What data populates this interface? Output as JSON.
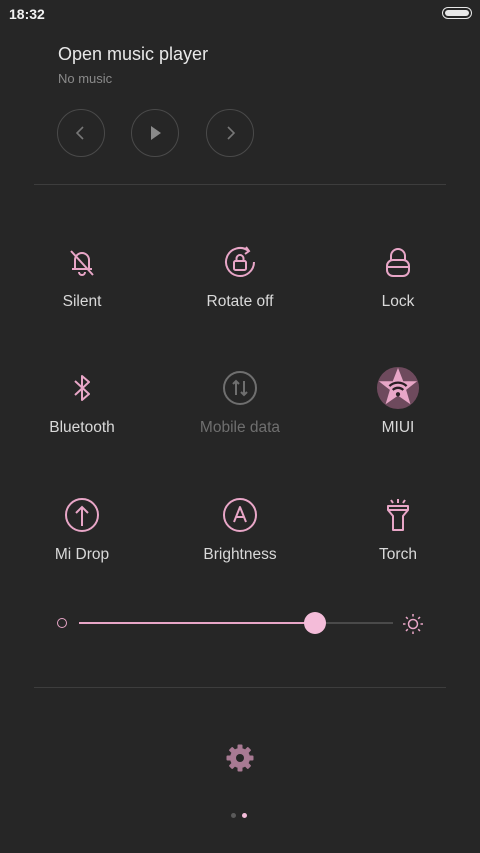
{
  "status_bar": {
    "time": "18:32"
  },
  "music": {
    "title": "Open music player",
    "subtitle": "No music",
    "controls": [
      "previous",
      "play",
      "next"
    ]
  },
  "tiles": [
    {
      "label": "Silent",
      "icon": "bell-off-icon",
      "enabled": true
    },
    {
      "label": "Rotate off",
      "icon": "rotate-lock-icon",
      "enabled": true
    },
    {
      "label": "Lock",
      "icon": "lock-icon",
      "enabled": true
    },
    {
      "label": "Bluetooth",
      "icon": "bluetooth-icon",
      "enabled": true
    },
    {
      "label": "Mobile data",
      "icon": "mobile-data-icon",
      "enabled": false
    },
    {
      "label": "MIUI",
      "icon": "wifi-icon",
      "enabled": true,
      "active": true
    },
    {
      "label": "Mi Drop",
      "icon": "upload-icon",
      "enabled": true
    },
    {
      "label": "Brightness",
      "icon": "auto-brightness-icon",
      "enabled": true
    },
    {
      "label": "Torch",
      "icon": "torch-icon",
      "enabled": true
    }
  ],
  "brightness": {
    "value_fraction": 0.75
  },
  "page_indicator": {
    "count": 2,
    "current": 2
  },
  "colors": {
    "background": "#262626",
    "accent": "#e8a6c7",
    "accent_light": "#f4bcd9",
    "dim": "#6f6f6f"
  }
}
